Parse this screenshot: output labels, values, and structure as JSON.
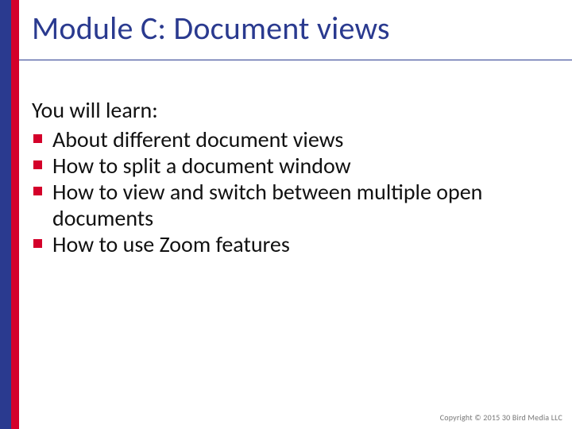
{
  "colors": {
    "brand_blue": "#2a3a8f",
    "brand_red": "#d4002a",
    "text": "#111111",
    "footer": "#777777"
  },
  "title": "Module C: Document  views",
  "intro": "You will learn:",
  "bullets": [
    "About different document views",
    "How to split a document window",
    "How to view and switch between multiple open documents",
    "How to use Zoom  features"
  ],
  "footer": "Copyright © 2015 30 Bird Media LLC"
}
